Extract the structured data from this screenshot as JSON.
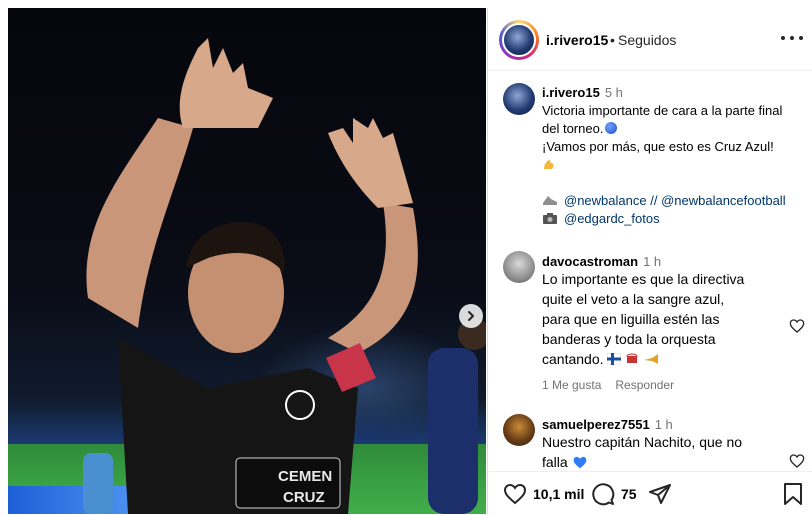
{
  "post": {
    "author": "i.rivero15",
    "follow_status": "Seguidos",
    "separator": "•"
  },
  "caption": {
    "username": "i.rivero15",
    "time": "5 h",
    "line1": "Victoria importante de cara a la parte final",
    "line2": "del torneo.",
    "line3": "¡Vamos por más, que esto es Cruz Azul!",
    "mention1": "@newbalance",
    "mention_separator": "//",
    "mention2": "@newbalancefootball",
    "mention3": "@edgardc_fotos"
  },
  "comments": [
    {
      "username": "davocastroman",
      "time": "1 h",
      "lines": [
        "Lo importante es que la directiva",
        "quite el veto a la sangre azul,",
        "para que en liguilla estén las",
        "banderas y toda la orquesta",
        "cantando."
      ],
      "likes": "1 Me gusta",
      "reply": "Responder"
    },
    {
      "username": "samuelperez7551",
      "time": "1 h",
      "lines": [
        "Nuestro capitán Nachito, que no",
        "falla"
      ]
    }
  ],
  "actions": {
    "likes_count": "10,1 mil",
    "comments_count": "75"
  },
  "icons": {
    "like": "heart-icon",
    "comment": "comment-icon",
    "share": "share-icon",
    "save": "bookmark-icon",
    "more": "more-icon",
    "next": "chevron-right-icon"
  },
  "colors": {
    "link": "#00376b",
    "muted": "#737373",
    "border": "#dbdbdb"
  }
}
